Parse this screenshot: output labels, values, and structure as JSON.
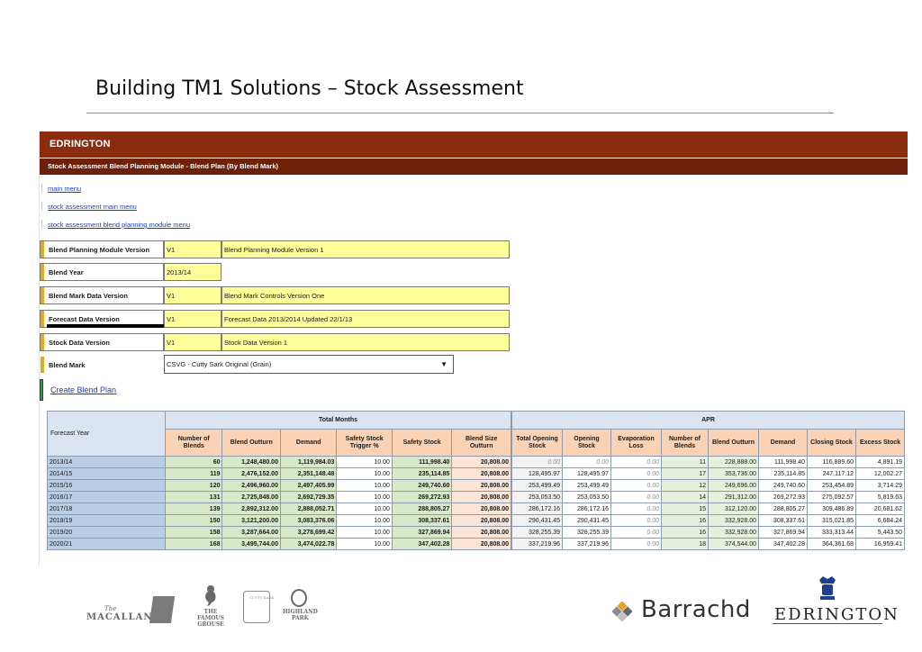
{
  "slide": {
    "title": "Building TM1 Solutions – Stock Assessment"
  },
  "app": {
    "brand": "EDRINGTON",
    "subtitle": "Stock Assessment Blend Planning Module - Blend Plan (By Blend Mark)",
    "nav": [
      "main menu",
      "stock assessment main menu",
      "stock assessment blend planning module menu"
    ],
    "params": [
      {
        "label": "Blend Planning Module Version",
        "code": "V1",
        "desc": "Blend Planning Module Version 1"
      },
      {
        "label": "Blend Year",
        "code": "2013/14",
        "desc": ""
      },
      {
        "label": "Blend Mark Data Version",
        "code": "V1",
        "desc": "Blend Mark Controls Version One"
      },
      {
        "label": "Forecast Data Version",
        "code": "V1",
        "desc": "Forecast Data 2013/2014 Updated 22/1/13"
      },
      {
        "label": "Stock Data Version",
        "code": "V1",
        "desc": "Stock Data Version 1"
      }
    ],
    "blend_mark": {
      "label": "Blend Mark",
      "value": "CSVG - Cutty Sark Original (Grain)"
    },
    "create_link": "Create Blend Plan"
  },
  "table": {
    "corner": "Forecast Year",
    "group_left": "Total Months",
    "group_right": "APR",
    "cols_left": [
      "Number of Blends",
      "Blend Outturn",
      "Demand",
      "Safety Stock Trigger %",
      "Safety Stock",
      "Blend Size Outturn"
    ],
    "cols_right": [
      "Total Opening Stock",
      "Opening Stock",
      "Evaporation Loss",
      "Number of Blends",
      "Blend Outturn",
      "Demand",
      "Closing Stock",
      "Excess Stock"
    ],
    "rows": [
      {
        "year": "2013/14",
        "l": [
          "60",
          "1,248,480.00",
          "1,119,984.03",
          "10.00",
          "111,998.40",
          "20,808.00"
        ],
        "r": [
          "0.00",
          "0.00",
          "0.00",
          "11",
          "228,888.00",
          "111,998.40",
          "116,889.60",
          "4,891.19"
        ]
      },
      {
        "year": "2014/15",
        "l": [
          "119",
          "2,476,152.00",
          "2,351,148.48",
          "10.00",
          "235,114.85",
          "20,808.00"
        ],
        "r": [
          "128,495.97",
          "128,495.97",
          "0.00",
          "17",
          "353,736.00",
          "235,114.85",
          "247,117.12",
          "12,002.27"
        ]
      },
      {
        "year": "2015/16",
        "l": [
          "120",
          "2,496,960.00",
          "2,497,405.99",
          "10.00",
          "249,740.60",
          "20,808.00"
        ],
        "r": [
          "253,499.49",
          "253,499.49",
          "0.00",
          "12",
          "249,696.00",
          "249,740.60",
          "253,454.89",
          "3,714.29"
        ]
      },
      {
        "year": "2016/17",
        "l": [
          "131",
          "2,725,848.00",
          "2,692,729.35",
          "10.00",
          "269,272.93",
          "20,808.00"
        ],
        "r": [
          "253,053.50",
          "253,053.50",
          "0.00",
          "14",
          "291,312.00",
          "269,272.93",
          "275,092.57",
          "5,819.63"
        ]
      },
      {
        "year": "2017/18",
        "l": [
          "139",
          "2,892,312.00",
          "2,888,052.71",
          "10.00",
          "288,805.27",
          "20,808.00"
        ],
        "r": [
          "286,172.16",
          "286,172.16",
          "0.00",
          "15",
          "312,120.00",
          "288,805.27",
          "309,486.89",
          "20,681.62"
        ]
      },
      {
        "year": "2018/19",
        "l": [
          "150",
          "3,121,200.00",
          "3,083,376.06",
          "10.00",
          "308,337.61",
          "20,808.00"
        ],
        "r": [
          "290,431.45",
          "290,431.45",
          "0.00",
          "16",
          "332,928.00",
          "308,337.61",
          "315,021.85",
          "6,684.24"
        ]
      },
      {
        "year": "2019/20",
        "l": [
          "158",
          "3,287,664.00",
          "3,278,699.42",
          "10.00",
          "327,869.94",
          "20,808.00"
        ],
        "r": [
          "328,255.39",
          "328,255.39",
          "0.00",
          "16",
          "332,928.00",
          "327,869.94",
          "333,313.44",
          "5,443.50"
        ]
      },
      {
        "year": "2020/21",
        "l": [
          "168",
          "3,495,744.00",
          "3,474,022.78",
          "10.00",
          "347,402.28",
          "20,808.00"
        ],
        "r": [
          "337,219.96",
          "337,219.96",
          "0.00",
          "18",
          "374,544.00",
          "347,402.28",
          "364,361.68",
          "16,959.41"
        ]
      }
    ]
  },
  "footer": {
    "macallan": "MACALLAN",
    "macallan_script": "The",
    "grouse": [
      "THE",
      "FAMOUS",
      "GROUSE"
    ],
    "cutty": "CUTTY SARK",
    "highland": [
      "HIGHLAND",
      "PARK"
    ],
    "barrachd": "Barrachd",
    "edrington": "EDRINGTON"
  },
  "colors": {
    "banner": "#8a2d0e",
    "subbanner": "#6e2008",
    "param_fill": "#ffff99",
    "accent_orange": "#e3a91a",
    "accent_green": "#2e9e46",
    "link": "#1f3fb0"
  }
}
